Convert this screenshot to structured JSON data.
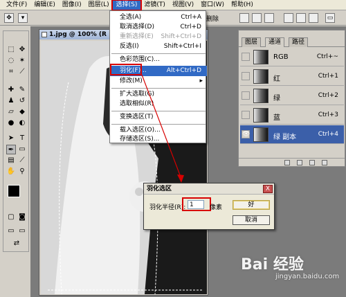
{
  "menubar": {
    "items": [
      "文件(F)",
      "编辑(E)",
      "图像(I)",
      "图层(L)",
      "选择(S)",
      "滤镜(T)",
      "视图(V)",
      "窗口(W)",
      "帮助(H)"
    ],
    "active_index": 4
  },
  "optbar": {
    "delete_label": "删除"
  },
  "document": {
    "title": "1.jpg @ 100% (R"
  },
  "select_menu": {
    "items": [
      {
        "label": "全选(A)",
        "shortcut": "Ctrl+A",
        "disabled": false
      },
      {
        "label": "取消选择(D)",
        "shortcut": "Ctrl+D",
        "disabled": false
      },
      {
        "label": "重新选择(E)",
        "shortcut": "Shift+Ctrl+D",
        "disabled": true
      },
      {
        "label": "反选(I)",
        "shortcut": "Shift+Ctrl+I",
        "disabled": false
      },
      {
        "label": "色彩范围(C)...",
        "shortcut": "",
        "disabled": false
      },
      {
        "label": "羽化(F)...",
        "shortcut": "Alt+Ctrl+D",
        "disabled": false
      },
      {
        "label": "修改(M)",
        "shortcut": "",
        "disabled": false
      },
      {
        "label": "扩大选取(G)",
        "shortcut": "",
        "disabled": false
      },
      {
        "label": "选取相似(R)",
        "shortcut": "",
        "disabled": false
      },
      {
        "label": "变换选区(T)",
        "shortcut": "",
        "disabled": false
      },
      {
        "label": "载入选区(O)...",
        "shortcut": "",
        "disabled": false
      },
      {
        "label": "存储选区(S)...",
        "shortcut": "",
        "disabled": false
      }
    ],
    "highlight_index": 5
  },
  "panel": {
    "tabs": [
      "图层",
      "通道",
      "路径"
    ],
    "active_tab": 1,
    "channels": [
      {
        "name": "RGB",
        "shortcut": "Ctrl+~"
      },
      {
        "name": "红",
        "shortcut": "Ctrl+1"
      },
      {
        "name": "绿",
        "shortcut": "Ctrl+2"
      },
      {
        "name": "蓝",
        "shortcut": "Ctrl+3"
      },
      {
        "name": "绿 副本",
        "shortcut": "Ctrl+4"
      }
    ],
    "selected_channel": 4
  },
  "feather_dialog": {
    "title": "羽化选区",
    "radius_label": "羽化半径(R):",
    "radius_value": "1",
    "unit": "像素",
    "ok_label": "好",
    "cancel_label": "取消",
    "close_label": "X"
  },
  "watermark": {
    "brand": "Bai 经验",
    "url": "jingyan.baidu.com"
  },
  "colors": {
    "highlight_red": "#d80000",
    "menu_select_blue": "#316ac5",
    "channel_select": "#3b5fa9"
  }
}
